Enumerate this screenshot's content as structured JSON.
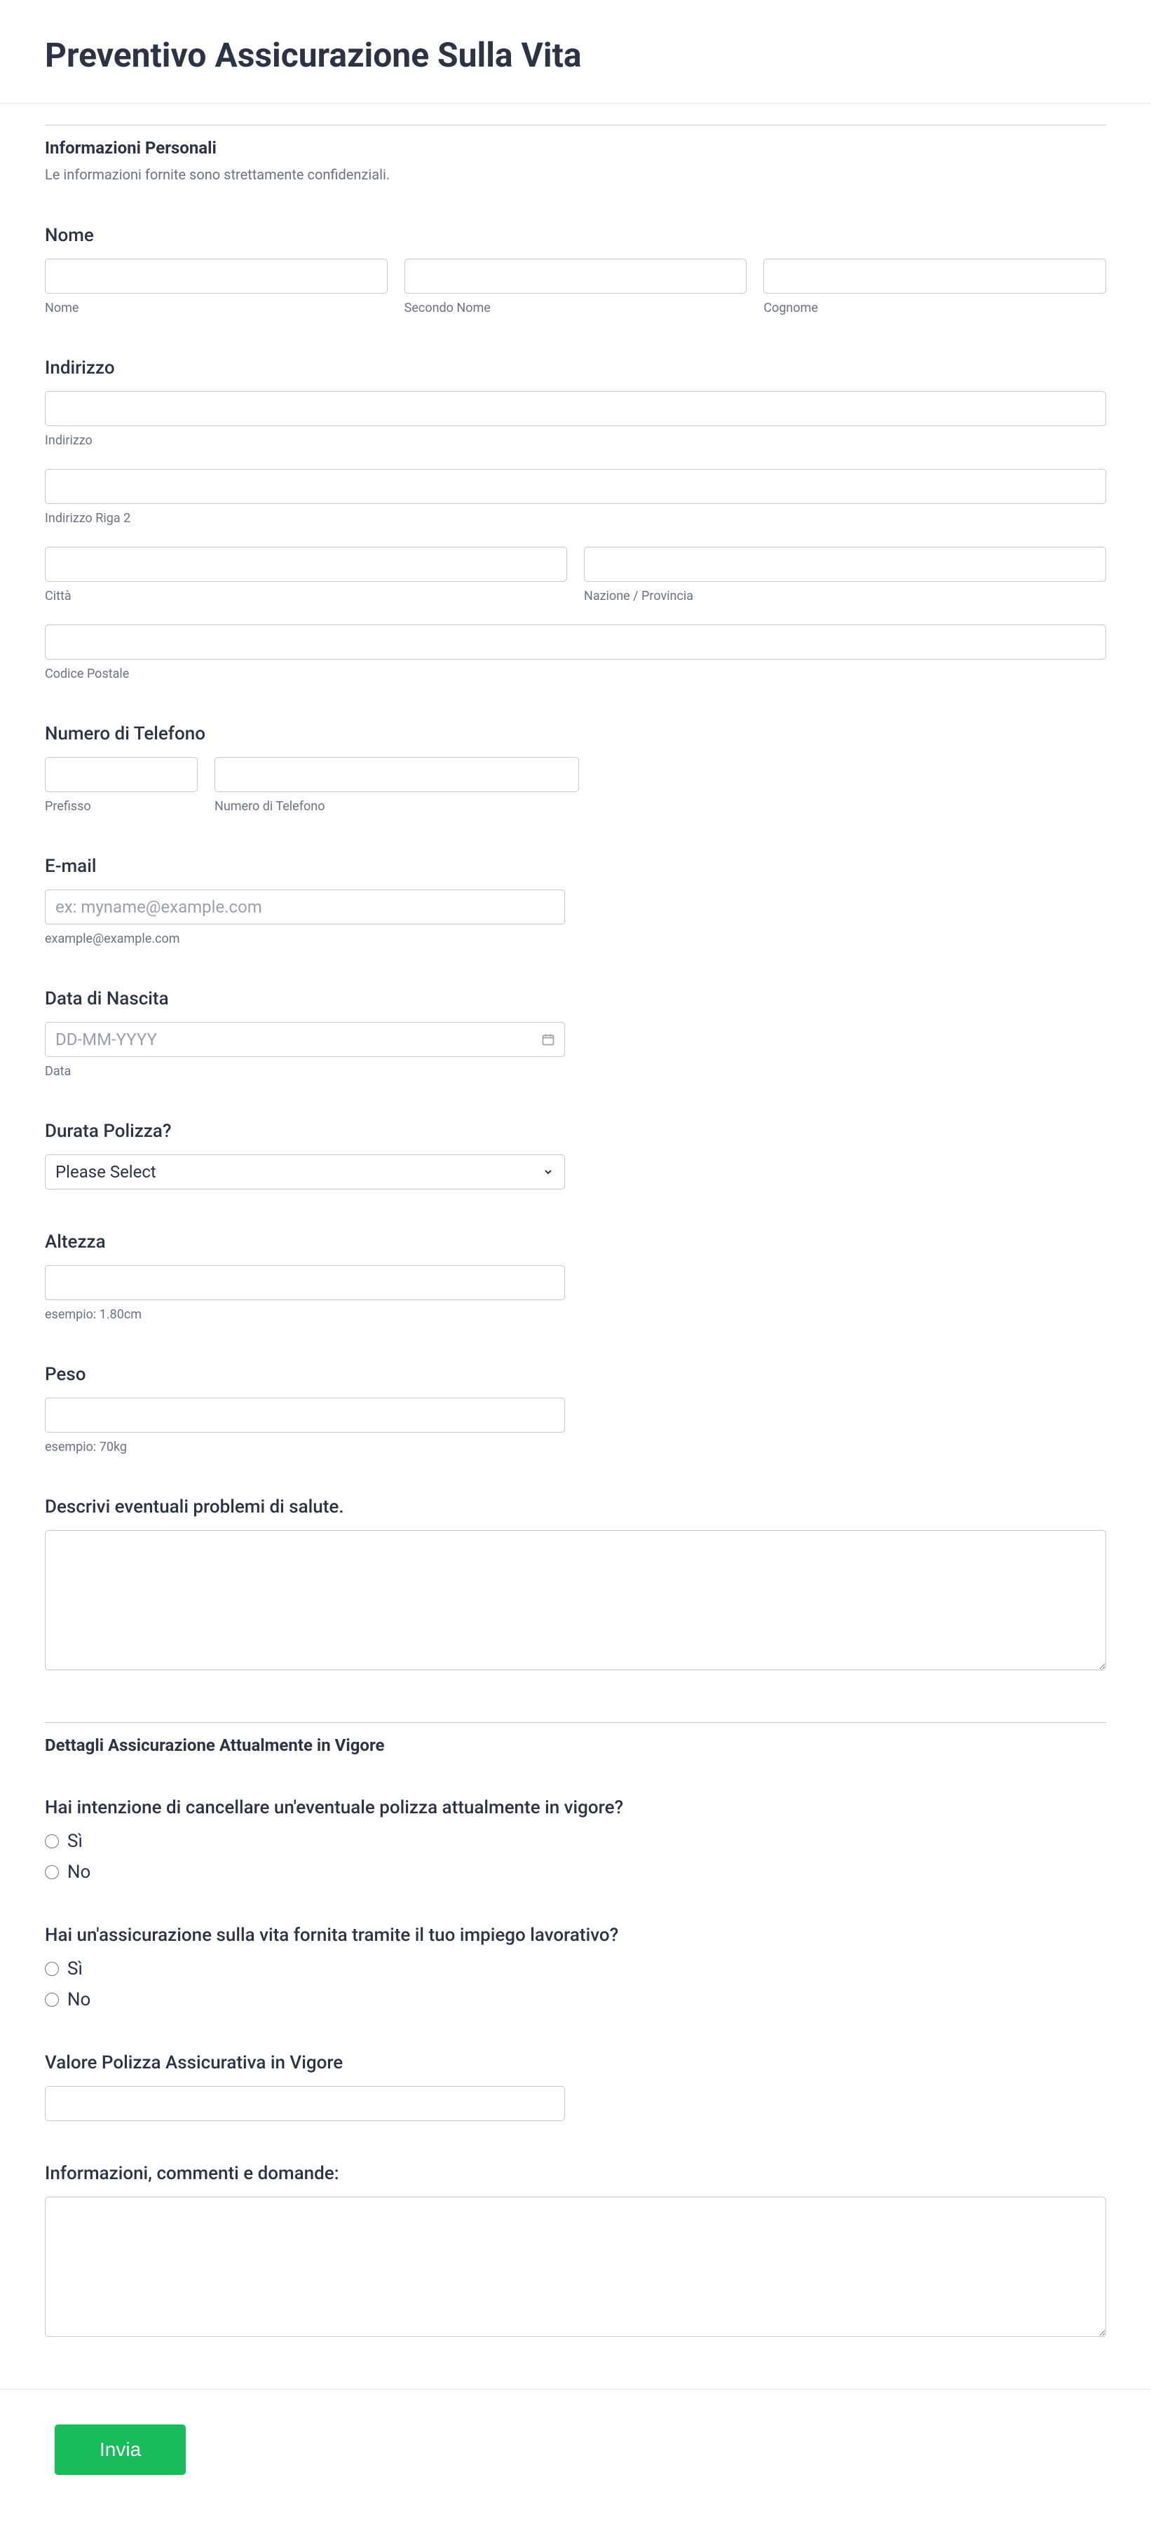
{
  "header": {
    "title": "Preventivo Assicurazione Sulla Vita"
  },
  "section1": {
    "title": "Informazioni Personali",
    "subtitle": "Le informazioni fornite sono strettamente confidenziali."
  },
  "name": {
    "label": "Nome",
    "first_sub": "Nome",
    "middle_sub": "Secondo Nome",
    "last_sub": "Cognome"
  },
  "address": {
    "label": "Indirizzo",
    "line1_sub": "Indirizzo",
    "line2_sub": "Indirizzo Riga 2",
    "city_sub": "Città",
    "state_sub": "Nazione / Provincia",
    "postal_sub": "Codice Postale"
  },
  "phone": {
    "label": "Numero di Telefono",
    "prefix_sub": "Prefisso",
    "number_sub": "Numero di Telefono"
  },
  "email": {
    "label": "E-mail",
    "placeholder": "ex: myname@example.com",
    "sub": "example@example.com"
  },
  "dob": {
    "label": "Data di Nascita",
    "placeholder": "DD-MM-YYYY",
    "sub": "Data"
  },
  "policy_duration": {
    "label": "Durata Polizza?",
    "selected": "Please Select"
  },
  "height": {
    "label": "Altezza",
    "sub": "esempio: 1.80cm"
  },
  "weight": {
    "label": "Peso",
    "sub": "esempio: 70kg"
  },
  "health": {
    "label": "Descrivi eventuali problemi di salute."
  },
  "section2": {
    "title": "Dettagli Assicurazione Attualmente in Vigore"
  },
  "cancel_policy": {
    "label": "Hai intenzione di cancellare un'eventuale polizza attualmente in vigore?",
    "opt_yes": "Sì",
    "opt_no": "No"
  },
  "employer_ins": {
    "label": "Hai un'assicurazione sulla vita fornita tramite il tuo impiego lavorativo?",
    "opt_yes": "Sì",
    "opt_no": "No"
  },
  "policy_value": {
    "label": "Valore Polizza Assicurativa in Vigore"
  },
  "comments": {
    "label": "Informazioni, commenti e domande:"
  },
  "submit": {
    "label": "Invia"
  }
}
